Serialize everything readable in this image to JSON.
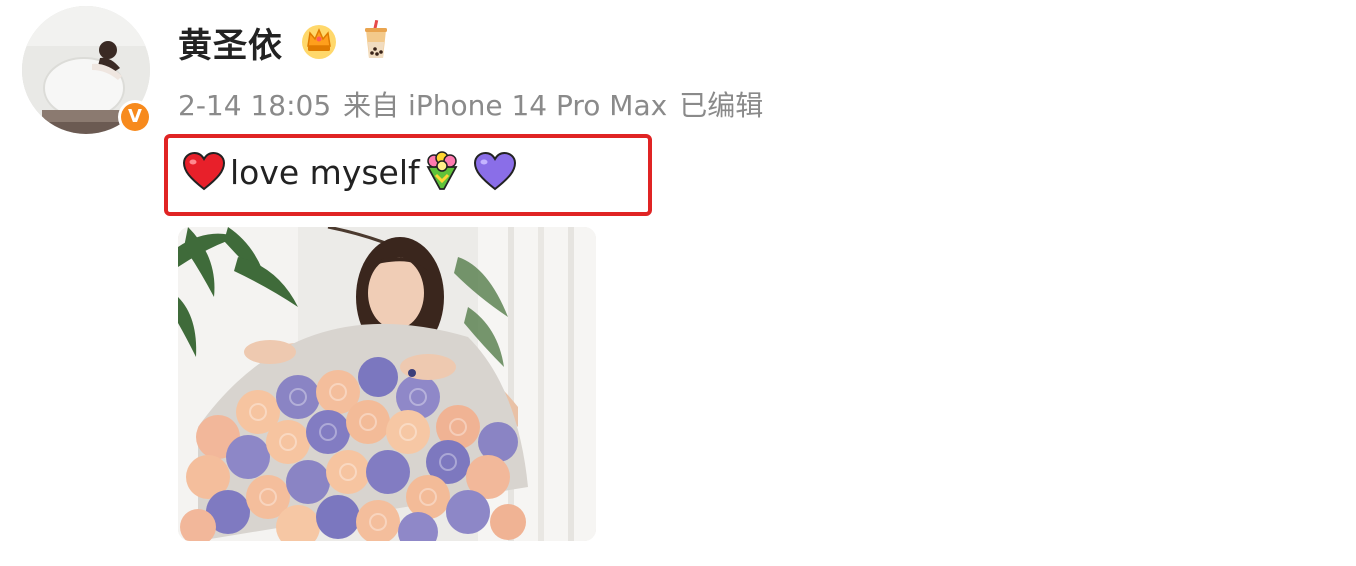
{
  "user": {
    "name": "黄圣依",
    "verified_mark": "V",
    "badges": [
      "crown-icon",
      "bubble-tea-icon"
    ]
  },
  "meta": {
    "time": "2-14 18:05",
    "source": "来自 iPhone 14 Pro Max",
    "edited": "已编辑"
  },
  "post": {
    "text": "love myself",
    "emojis": [
      "red-heart-icon",
      "bouquet-icon",
      "purple-heart-icon"
    ]
  },
  "colors": {
    "highlight_border": "#e02424",
    "verified_badge": "#f78a1d",
    "meta_text": "#8a8a8a"
  }
}
